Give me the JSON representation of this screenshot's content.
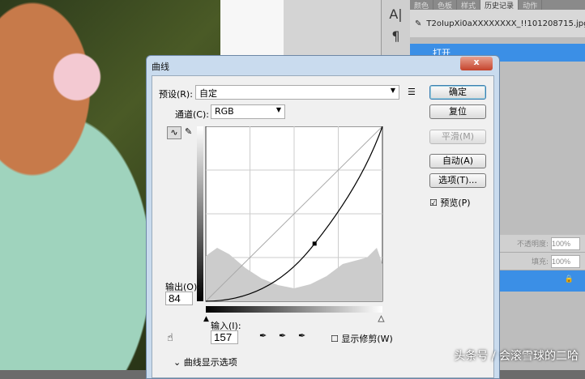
{
  "panel": {
    "tabs": [
      "颜色",
      "色板",
      "样式",
      "历史记录",
      "动作"
    ],
    "active_tab": 3,
    "snapshot": "T2oIupXi0aXXXXXXXX_!!101208715.jpg",
    "history_item": "打开",
    "opacity_label": "不透明度:",
    "opacity": "100%",
    "fill_label": "填充:",
    "fill": "100%"
  },
  "tools": {
    "text_icon": "A|",
    "para_icon": "¶"
  },
  "dialog": {
    "title": "曲线",
    "close": "x",
    "preset_label": "预设(R):",
    "preset_value": "自定",
    "channel_label": "通道(C):",
    "channel_value": "RGB",
    "buttons": {
      "ok": "确定",
      "reset": "复位",
      "smooth": "平滑(M)",
      "auto": "自动(A)",
      "options": "选项(T)..."
    },
    "preview_label": "预览(P)",
    "preview_checked": true,
    "output_label": "输出(O):",
    "output_value": "84",
    "input_label": "输入(I):",
    "input_value": "157",
    "show_clipping": "显示修剪(W)",
    "curve_options": "曲线显示选项"
  },
  "watermark": "头条号 / 会滚雪球的二哈"
}
